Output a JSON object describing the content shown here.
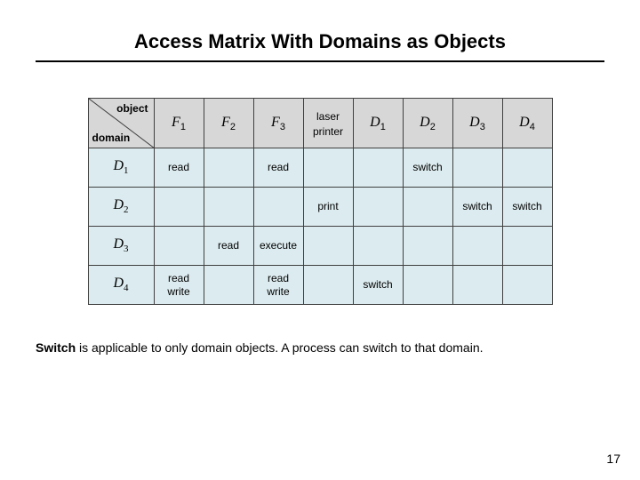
{
  "title": "Access Matrix  With Domains as Objects",
  "diag": {
    "top": "object",
    "bottom": "domain"
  },
  "cols": [
    {
      "sym": "F",
      "sub": "1"
    },
    {
      "sym": "F",
      "sub": "2"
    },
    {
      "sym": "F",
      "sub": "3"
    },
    {
      "plain": "laser\nprinter"
    },
    {
      "sym": "D",
      "sub": "1"
    },
    {
      "sym": "D",
      "sub": "2"
    },
    {
      "sym": "D",
      "sub": "3"
    },
    {
      "sym": "D",
      "sub": "4"
    }
  ],
  "rows": [
    {
      "head": {
        "sym": "D",
        "sub": "1"
      },
      "cells": [
        "read",
        "",
        "read",
        "",
        "",
        "switch",
        "",
        ""
      ]
    },
    {
      "head": {
        "sym": "D",
        "sub": "2"
      },
      "cells": [
        "",
        "",
        "",
        "print",
        "",
        "",
        "switch",
        "switch"
      ]
    },
    {
      "head": {
        "sym": "D",
        "sub": "3"
      },
      "cells": [
        "",
        "read",
        "execute",
        "",
        "",
        "",
        "",
        ""
      ]
    },
    {
      "head": {
        "sym": "D",
        "sub": "4"
      },
      "cells": [
        "read\nwrite",
        "",
        "read\nwrite",
        "",
        "switch",
        "",
        "",
        ""
      ]
    }
  ],
  "caption": {
    "lead": "Switch",
    "rest": " is applicable to only domain objects. A process can switch to that domain."
  },
  "page": "17",
  "chart_data": {
    "type": "table",
    "title": "Access Matrix With Domains as Objects",
    "row_label": "domain",
    "col_label": "object",
    "columns": [
      "F1",
      "F2",
      "F3",
      "laser printer",
      "D1",
      "D2",
      "D3",
      "D4"
    ],
    "rows": [
      "D1",
      "D2",
      "D3",
      "D4"
    ],
    "cells": [
      [
        "read",
        "",
        "read",
        "",
        "",
        "switch",
        "",
        ""
      ],
      [
        "",
        "",
        "",
        "print",
        "",
        "",
        "switch",
        "switch"
      ],
      [
        "",
        "read",
        "execute",
        "",
        "",
        "",
        "",
        ""
      ],
      [
        "read write",
        "",
        "read write",
        "",
        "switch",
        "",
        "",
        ""
      ]
    ]
  }
}
